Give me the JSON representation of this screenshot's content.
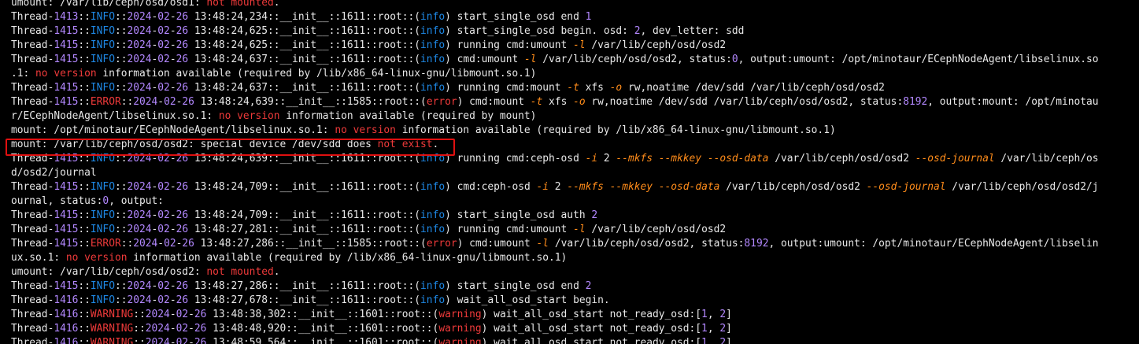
{
  "terminal": {
    "lines": [
      [
        [
          "t",
          "umount: /var/lib/ceph/osd/osd1: "
        ],
        [
          "r",
          "not mounted"
        ],
        [
          "t",
          "."
        ]
      ],
      [
        [
          "t",
          "Thread-"
        ],
        [
          "n",
          "1413"
        ],
        [
          "t",
          "::"
        ],
        [
          "i",
          "INFO"
        ],
        [
          "t",
          "::"
        ],
        [
          "n",
          "2024"
        ],
        [
          "t",
          "-"
        ],
        [
          "n",
          "02"
        ],
        [
          "t",
          "-"
        ],
        [
          "n",
          "26"
        ],
        [
          "t",
          " 13:48:24,234::__init__::1611::root::("
        ],
        [
          "i",
          "info"
        ],
        [
          "t",
          ") start_single_osd end "
        ],
        [
          "n",
          "1"
        ]
      ],
      [
        [
          "t",
          "Thread-"
        ],
        [
          "n",
          "1415"
        ],
        [
          "t",
          "::"
        ],
        [
          "i",
          "INFO"
        ],
        [
          "t",
          "::"
        ],
        [
          "n",
          "2024"
        ],
        [
          "t",
          "-"
        ],
        [
          "n",
          "02"
        ],
        [
          "t",
          "-"
        ],
        [
          "n",
          "26"
        ],
        [
          "t",
          " 13:48:24,625::__init__::1611::root::("
        ],
        [
          "i",
          "info"
        ],
        [
          "t",
          ") start_single_osd begin. osd: "
        ],
        [
          "n",
          "2"
        ],
        [
          "t",
          ", dev_letter: sdd"
        ]
      ],
      [
        [
          "t",
          "Thread-"
        ],
        [
          "n",
          "1415"
        ],
        [
          "t",
          "::"
        ],
        [
          "i",
          "INFO"
        ],
        [
          "t",
          "::"
        ],
        [
          "n",
          "2024"
        ],
        [
          "t",
          "-"
        ],
        [
          "n",
          "02"
        ],
        [
          "t",
          "-"
        ],
        [
          "n",
          "26"
        ],
        [
          "t",
          " 13:48:24,625::__init__::1611::root::("
        ],
        [
          "i",
          "info"
        ],
        [
          "t",
          ") running cmd:umount "
        ],
        [
          "f",
          "-l"
        ],
        [
          "t",
          " /var/lib/ceph/osd/osd2"
        ]
      ],
      [
        [
          "t",
          "Thread-"
        ],
        [
          "n",
          "1415"
        ],
        [
          "t",
          "::"
        ],
        [
          "i",
          "INFO"
        ],
        [
          "t",
          "::"
        ],
        [
          "n",
          "2024"
        ],
        [
          "t",
          "-"
        ],
        [
          "n",
          "02"
        ],
        [
          "t",
          "-"
        ],
        [
          "n",
          "26"
        ],
        [
          "t",
          " 13:48:24,637::__init__::1611::root::("
        ],
        [
          "i",
          "info"
        ],
        [
          "t",
          ") cmd:umount "
        ],
        [
          "f",
          "-l"
        ],
        [
          "t",
          " /var/lib/ceph/osd/osd2, status:"
        ],
        [
          "n",
          "0"
        ],
        [
          "t",
          ", output:umount: /opt/minotaur/ECephNodeAgent/libselinux.so"
        ]
      ],
      [
        [
          "t",
          ".1: "
        ],
        [
          "r",
          "no version"
        ],
        [
          "t",
          " information available (required by /lib/x86_64-linux-gnu/libmount.so.1)"
        ]
      ],
      [
        [
          "t",
          "Thread-"
        ],
        [
          "n",
          "1415"
        ],
        [
          "t",
          "::"
        ],
        [
          "i",
          "INFO"
        ],
        [
          "t",
          "::"
        ],
        [
          "n",
          "2024"
        ],
        [
          "t",
          "-"
        ],
        [
          "n",
          "02"
        ],
        [
          "t",
          "-"
        ],
        [
          "n",
          "26"
        ],
        [
          "t",
          " 13:48:24,637::__init__::1611::root::("
        ],
        [
          "i",
          "info"
        ],
        [
          "t",
          ") running cmd:mount "
        ],
        [
          "f",
          "-t"
        ],
        [
          "t",
          " xfs "
        ],
        [
          "f",
          "-o"
        ],
        [
          "t",
          " rw,noatime /dev/sdd /var/lib/ceph/osd/osd2"
        ]
      ],
      [
        [
          "t",
          "Thread-"
        ],
        [
          "n",
          "1415"
        ],
        [
          "t",
          "::"
        ],
        [
          "r",
          "ERROR"
        ],
        [
          "t",
          "::"
        ],
        [
          "n",
          "2024"
        ],
        [
          "t",
          "-"
        ],
        [
          "n",
          "02"
        ],
        [
          "t",
          "-"
        ],
        [
          "n",
          "26"
        ],
        [
          "t",
          " 13:48:24,639::__init__::1585::root::("
        ],
        [
          "r",
          "error"
        ],
        [
          "t",
          ") cmd:mount "
        ],
        [
          "f",
          "-t"
        ],
        [
          "t",
          " xfs "
        ],
        [
          "f",
          "-o"
        ],
        [
          "t",
          " rw,noatime /dev/sdd /var/lib/ceph/osd/osd2, status:"
        ],
        [
          "n",
          "8192"
        ],
        [
          "t",
          ", output:mount: /opt/minotau"
        ]
      ],
      [
        [
          "t",
          "r/ECephNodeAgent/libselinux.so.1: "
        ],
        [
          "r",
          "no version"
        ],
        [
          "t",
          " information available (required by mount)"
        ]
      ],
      [
        [
          "t",
          "mount: /opt/minotaur/ECephNodeAgent/libselinux.so.1: "
        ],
        [
          "r",
          "no version"
        ],
        [
          "t",
          " information available (required by /lib/x86_64-linux-gnu/libmount.so.1)"
        ]
      ],
      [
        [
          "t",
          "mount: /var/lib/ceph/osd/osd2: special device /dev/sdd does "
        ],
        [
          "r",
          "not exist"
        ],
        [
          "t",
          "."
        ]
      ],
      [
        [
          "t",
          "Thread-"
        ],
        [
          "n",
          "1415"
        ],
        [
          "t",
          "::"
        ],
        [
          "i",
          "INFO"
        ],
        [
          "t",
          "::"
        ],
        [
          "n",
          "2024"
        ],
        [
          "t",
          "-"
        ],
        [
          "n",
          "02"
        ],
        [
          "t",
          "-"
        ],
        [
          "n",
          "26"
        ],
        [
          "t",
          " 13:48:24,639::__init__::1611::root::("
        ],
        [
          "i",
          "info"
        ],
        [
          "t",
          ") running cmd:ceph-osd "
        ],
        [
          "f",
          "-i"
        ],
        [
          "t",
          " 2 "
        ],
        [
          "f",
          "--mkfs --mkkey --osd-data"
        ],
        [
          "t",
          " /var/lib/ceph/osd/osd2 "
        ],
        [
          "f",
          "--osd-journal"
        ],
        [
          "t",
          " /var/lib/ceph/os"
        ]
      ],
      [
        [
          "t",
          "d/osd2/journal"
        ]
      ],
      [
        [
          "t",
          "Thread-"
        ],
        [
          "n",
          "1415"
        ],
        [
          "t",
          "::"
        ],
        [
          "i",
          "INFO"
        ],
        [
          "t",
          "::"
        ],
        [
          "n",
          "2024"
        ],
        [
          "t",
          "-"
        ],
        [
          "n",
          "02"
        ],
        [
          "t",
          "-"
        ],
        [
          "n",
          "26"
        ],
        [
          "t",
          " 13:48:24,709::__init__::1611::root::("
        ],
        [
          "i",
          "info"
        ],
        [
          "t",
          ") cmd:ceph-osd "
        ],
        [
          "f",
          "-i"
        ],
        [
          "t",
          " 2 "
        ],
        [
          "f",
          "--mkfs --mkkey --osd-data"
        ],
        [
          "t",
          " /var/lib/ceph/osd/osd2 "
        ],
        [
          "f",
          "--osd-journal"
        ],
        [
          "t",
          " /var/lib/ceph/osd/osd2/j"
        ]
      ],
      [
        [
          "t",
          "ournal, status:"
        ],
        [
          "n",
          "0"
        ],
        [
          "t",
          ", output:"
        ]
      ],
      [
        [
          "t",
          "Thread-"
        ],
        [
          "n",
          "1415"
        ],
        [
          "t",
          "::"
        ],
        [
          "i",
          "INFO"
        ],
        [
          "t",
          "::"
        ],
        [
          "n",
          "2024"
        ],
        [
          "t",
          "-"
        ],
        [
          "n",
          "02"
        ],
        [
          "t",
          "-"
        ],
        [
          "n",
          "26"
        ],
        [
          "t",
          " 13:48:24,709::__init__::1611::root::("
        ],
        [
          "i",
          "info"
        ],
        [
          "t",
          ") start_single_osd auth "
        ],
        [
          "n",
          "2"
        ]
      ],
      [
        [
          "t",
          "Thread-"
        ],
        [
          "n",
          "1415"
        ],
        [
          "t",
          "::"
        ],
        [
          "i",
          "INFO"
        ],
        [
          "t",
          "::"
        ],
        [
          "n",
          "2024"
        ],
        [
          "t",
          "-"
        ],
        [
          "n",
          "02"
        ],
        [
          "t",
          "-"
        ],
        [
          "n",
          "26"
        ],
        [
          "t",
          " 13:48:27,281::__init__::1611::root::("
        ],
        [
          "i",
          "info"
        ],
        [
          "t",
          ") running cmd:umount "
        ],
        [
          "f",
          "-l"
        ],
        [
          "t",
          " /var/lib/ceph/osd/osd2"
        ]
      ],
      [
        [
          "t",
          "Thread-"
        ],
        [
          "n",
          "1415"
        ],
        [
          "t",
          "::"
        ],
        [
          "r",
          "ERROR"
        ],
        [
          "t",
          "::"
        ],
        [
          "n",
          "2024"
        ],
        [
          "t",
          "-"
        ],
        [
          "n",
          "02"
        ],
        [
          "t",
          "-"
        ],
        [
          "n",
          "26"
        ],
        [
          "t",
          " 13:48:27,286::__init__::1585::root::("
        ],
        [
          "r",
          "error"
        ],
        [
          "t",
          ") cmd:umount "
        ],
        [
          "f",
          "-l"
        ],
        [
          "t",
          " /var/lib/ceph/osd/osd2, status:"
        ],
        [
          "n",
          "8192"
        ],
        [
          "t",
          ", output:umount: /opt/minotaur/ECephNodeAgent/libselin"
        ]
      ],
      [
        [
          "t",
          "ux.so.1: "
        ],
        [
          "r",
          "no version"
        ],
        [
          "t",
          " information available (required by /lib/x86_64-linux-gnu/libmount.so.1)"
        ]
      ],
      [
        [
          "t",
          "umount: /var/lib/ceph/osd/osd2: "
        ],
        [
          "r",
          "not mounted"
        ],
        [
          "t",
          "."
        ]
      ],
      [
        [
          "t",
          "Thread-"
        ],
        [
          "n",
          "1415"
        ],
        [
          "t",
          "::"
        ],
        [
          "i",
          "INFO"
        ],
        [
          "t",
          "::"
        ],
        [
          "n",
          "2024"
        ],
        [
          "t",
          "-"
        ],
        [
          "n",
          "02"
        ],
        [
          "t",
          "-"
        ],
        [
          "n",
          "26"
        ],
        [
          "t",
          " 13:48:27,286::__init__::1611::root::("
        ],
        [
          "i",
          "info"
        ],
        [
          "t",
          ") start_single_osd end "
        ],
        [
          "n",
          "2"
        ]
      ],
      [
        [
          "t",
          "Thread-"
        ],
        [
          "n",
          "1416"
        ],
        [
          "t",
          "::"
        ],
        [
          "i",
          "INFO"
        ],
        [
          "t",
          "::"
        ],
        [
          "n",
          "2024"
        ],
        [
          "t",
          "-"
        ],
        [
          "n",
          "02"
        ],
        [
          "t",
          "-"
        ],
        [
          "n",
          "26"
        ],
        [
          "t",
          " 13:48:27,678::__init__::1611::root::("
        ],
        [
          "i",
          "info"
        ],
        [
          "t",
          ") wait_all_osd_start begin."
        ]
      ],
      [
        [
          "t",
          "Thread-"
        ],
        [
          "n",
          "1416"
        ],
        [
          "t",
          "::"
        ],
        [
          "w",
          "WARNING"
        ],
        [
          "t",
          "::"
        ],
        [
          "n",
          "2024"
        ],
        [
          "t",
          "-"
        ],
        [
          "n",
          "02"
        ],
        [
          "t",
          "-"
        ],
        [
          "n",
          "26"
        ],
        [
          "t",
          " 13:48:38,302::__init__::1601::root::("
        ],
        [
          "w",
          "warning"
        ],
        [
          "t",
          ") wait_all_osd_start not_ready_osd:["
        ],
        [
          "n",
          "1"
        ],
        [
          "t",
          ", "
        ],
        [
          "n",
          "2"
        ],
        [
          "t",
          "]"
        ]
      ],
      [
        [
          "t",
          "Thread-"
        ],
        [
          "n",
          "1416"
        ],
        [
          "t",
          "::"
        ],
        [
          "w",
          "WARNING"
        ],
        [
          "t",
          "::"
        ],
        [
          "n",
          "2024"
        ],
        [
          "t",
          "-"
        ],
        [
          "n",
          "02"
        ],
        [
          "t",
          "-"
        ],
        [
          "n",
          "26"
        ],
        [
          "t",
          " 13:48:48,920::__init__::1601::root::("
        ],
        [
          "w",
          "warning"
        ],
        [
          "t",
          ") wait_all_osd_start not_ready_osd:["
        ],
        [
          "n",
          "1"
        ],
        [
          "t",
          ", "
        ],
        [
          "n",
          "2"
        ],
        [
          "t",
          "]"
        ]
      ],
      [
        [
          "t",
          "Thread-"
        ],
        [
          "n",
          "1416"
        ],
        [
          "t",
          "::"
        ],
        [
          "w",
          "WARNING"
        ],
        [
          "t",
          "::"
        ],
        [
          "n",
          "2024"
        ],
        [
          "t",
          "-"
        ],
        [
          "n",
          "02"
        ],
        [
          "t",
          "-"
        ],
        [
          "n",
          "26"
        ],
        [
          "t",
          " 13:48:59,564::__init__::1601::root::("
        ],
        [
          "w",
          "warning"
        ],
        [
          "t",
          ") wait_all_osd_start not_ready_osd:["
        ],
        [
          "n",
          "1"
        ],
        [
          "t",
          ", "
        ],
        [
          "n",
          "2"
        ],
        [
          "t",
          "]"
        ]
      ]
    ],
    "highlighted_line_index": 10
  },
  "colors": {
    "background": "#000000",
    "text": "#e8e8e8",
    "info": "#1e88e5",
    "number": "#b388ff",
    "error": "#ef3a3a",
    "flag": "#ff8c1a",
    "highlight_box": "#e01010"
  }
}
